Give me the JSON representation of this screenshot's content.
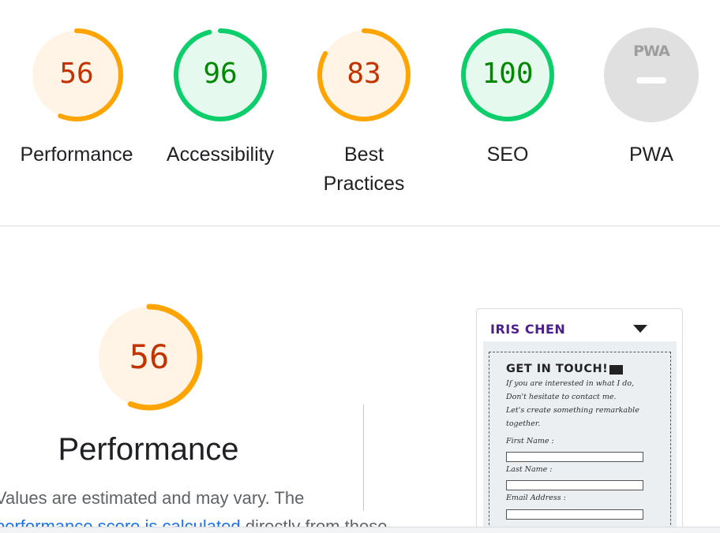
{
  "scores": [
    {
      "value": "56",
      "label": "Performance",
      "fraction": 0.56,
      "color": "#ffa400",
      "text_color": "#c33300",
      "bg": "#fff4e5"
    },
    {
      "value": "96",
      "label": "Accessibility",
      "fraction": 0.96,
      "color": "#0cce6b",
      "text_color": "#008800",
      "bg": "#e6f9ee"
    },
    {
      "value": "83",
      "label": "Best Practices",
      "fraction": 0.83,
      "color": "#ffa400",
      "text_color": "#c33300",
      "bg": "#fff4e5"
    },
    {
      "value": "100",
      "label": "SEO",
      "fraction": 1.0,
      "color": "#0cce6b",
      "text_color": "#008800",
      "bg": "#e6f9ee"
    }
  ],
  "pwa": {
    "badge": "PWA",
    "label": "PWA",
    "color": "#e0e0e0"
  },
  "performance": {
    "score": "56",
    "fraction": 0.56,
    "title": "Performance",
    "desc_line1": "Values are estimated and may vary. The",
    "desc_link": "performance score is calculated",
    "desc_line2_rest": " directly from these"
  },
  "screenshot": {
    "brand": "IRIS CHEN",
    "menu_icon": "caret-down-icon",
    "form_title": "GET IN TOUCH!",
    "form_icon": "envelope-icon",
    "intro_lines": [
      "If you are interested in what I do,",
      "Don't hesitate to contact me.",
      "Let's create something remarkable",
      "together."
    ],
    "fields": [
      "First Name :",
      "Last Name :",
      "Email Address :"
    ]
  }
}
